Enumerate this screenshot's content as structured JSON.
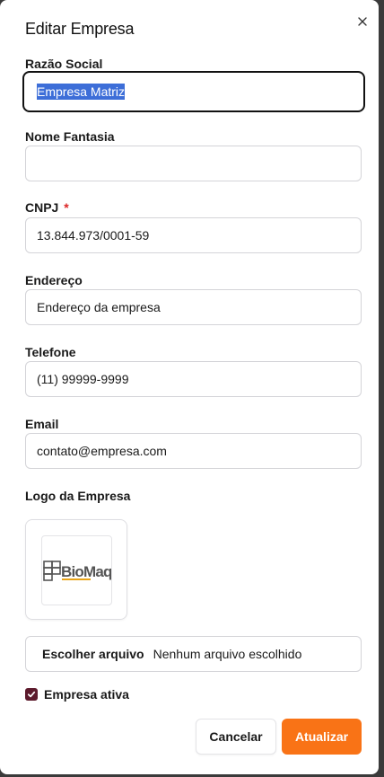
{
  "dialog": {
    "title": "Editar Empresa",
    "close_icon": "close-icon"
  },
  "fields": {
    "razao_social": {
      "label": "Razão Social",
      "value": "Empresa Matriz"
    },
    "nome_fantasia": {
      "label": "Nome Fantasia",
      "value": ""
    },
    "cnpj": {
      "label": "CNPJ",
      "required_mark": "*",
      "value": "13.844.973/0001-59"
    },
    "endereco": {
      "label": "Endereço",
      "value": "Endereço da empresa"
    },
    "telefone": {
      "label": "Telefone",
      "value": "(11) 99999-9999"
    },
    "email": {
      "label": "Email",
      "value": "contato@empresa.com"
    }
  },
  "logo": {
    "label": "Logo da Empresa",
    "brand_text": "BioMaq",
    "brand_colors": {
      "primary": "#555555",
      "accent": "#e8a317"
    }
  },
  "file_input": {
    "button_label": "Escolher arquivo",
    "status": "Nenhum arquivo escolhido"
  },
  "active": {
    "label": "Empresa ativa",
    "checked": true
  },
  "actions": {
    "cancel_label": "Cancelar",
    "submit_label": "Atualizar"
  },
  "colors": {
    "accent": "#f97316",
    "checkbox": "#5c1a2c",
    "required": "#dc2626",
    "selection": "#3d6ed8"
  }
}
